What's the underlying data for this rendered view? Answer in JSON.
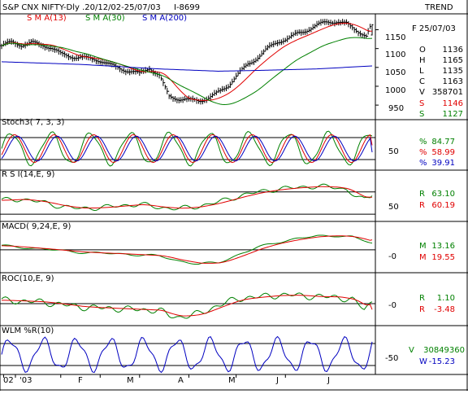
{
  "header": {
    "title": "S&P CNX NIFTY-Dly .20/12/02-25/07/03",
    "code": "I-8699",
    "trend_label": "TREND"
  },
  "colors": {
    "price": "#000000",
    "sma13": "#e00000",
    "sma30": "#008000",
    "sma200": "#0000c0",
    "osc_green": "#008000",
    "osc_red": "#e00000",
    "osc_blue": "#0000c0",
    "wlm": "#0000c0",
    "axis": "#000000"
  },
  "chart_data": [
    {
      "type": "line",
      "panel": "price",
      "title": "S&P CNX NIFTY-Dly .20/12/02-25/07/03",
      "ylim": [
        920,
        1190
      ],
      "y_ticks": [
        "1150",
        "1100",
        "1050",
        "1000",
        "950"
      ],
      "legend": [
        {
          "name": "S M A(13)",
          "color": "#e00000"
        },
        {
          "name": "S M A(30)",
          "color": "#008000"
        },
        {
          "name": "S M A(200)",
          "color": "#0000c0"
        }
      ],
      "readout": {
        "date": "F 25/07/03",
        "items": [
          {
            "k": "O",
            "v": "1136",
            "color": "#000000"
          },
          {
            "k": "H",
            "v": "1165",
            "color": "#000000"
          },
          {
            "k": "L",
            "v": "1135",
            "color": "#000000"
          },
          {
            "k": "C",
            "v": "1163",
            "color": "#000000"
          },
          {
            "k": "V",
            "v": "358701",
            "color": "#000000"
          },
          {
            "k": "S",
            "v": "1146",
            "color": "#e00000"
          },
          {
            "k": "S",
            "v": "1127",
            "color": "#008000"
          }
        ]
      },
      "close_anchors": [
        [
          0,
          1105
        ],
        [
          5,
          1115
        ],
        [
          10,
          1112
        ],
        [
          15,
          1118
        ],
        [
          20,
          1108
        ],
        [
          25,
          1100
        ],
        [
          30,
          1085
        ],
        [
          35,
          1082
        ],
        [
          40,
          1078
        ],
        [
          45,
          1070
        ],
        [
          50,
          1066
        ],
        [
          55,
          1058
        ],
        [
          60,
          1050
        ],
        [
          65,
          1040
        ],
        [
          70,
          1030
        ],
        [
          75,
          1048
        ],
        [
          80,
          1030
        ],
        [
          85,
          975
        ],
        [
          90,
          965
        ],
        [
          95,
          960
        ],
        [
          100,
          962
        ],
        [
          105,
          972
        ],
        [
          110,
          985
        ],
        [
          115,
          1000
        ],
        [
          120,
          1030
        ],
        [
          125,
          1060
        ],
        [
          130,
          1080
        ],
        [
          135,
          1100
        ],
        [
          140,
          1115
        ],
        [
          145,
          1125
        ],
        [
          150,
          1142
        ],
        [
          155,
          1152
        ],
        [
          160,
          1160
        ],
        [
          165,
          1168
        ],
        [
          170,
          1172
        ],
        [
          175,
          1168
        ],
        [
          180,
          1150
        ],
        [
          185,
          1130
        ],
        [
          188,
          1163
        ]
      ],
      "sma200_anchors": [
        [
          0,
          1065
        ],
        [
          40,
          1058
        ],
        [
          80,
          1046
        ],
        [
          110,
          1040
        ],
        [
          130,
          1042
        ],
        [
          160,
          1046
        ],
        [
          188,
          1054
        ]
      ],
      "sma13_final": 1146,
      "sma30_final": 1127
    },
    {
      "type": "line",
      "panel": "stoch",
      "title": "Stoch3( 7, 3, 3)",
      "ylim": [
        0,
        100
      ],
      "y_ticks": [
        "50"
      ],
      "ref_lines": [
        20,
        80
      ],
      "readout": {
        "items": [
          {
            "k": "%",
            "v": "84.77",
            "color": "#008000"
          },
          {
            "k": "%",
            "v": "58.99",
            "color": "#e00000"
          },
          {
            "k": "%",
            "v": "39.91",
            "color": "#0000c0"
          }
        ]
      }
    },
    {
      "type": "line",
      "panel": "rsi",
      "title": "R S I(14,E, 9)",
      "ylim": [
        20,
        90
      ],
      "y_ticks": [
        "50"
      ],
      "ref_lines": [
        70,
        30
      ],
      "readout": {
        "items": [
          {
            "k": "R",
            "v": "63.10",
            "color": "#008000"
          },
          {
            "k": "R",
            "v": "60.19",
            "color": "#e00000"
          }
        ]
      },
      "anchors": [
        [
          0,
          55
        ],
        [
          10,
          57
        ],
        [
          20,
          52
        ],
        [
          30,
          44
        ],
        [
          40,
          40
        ],
        [
          50,
          42
        ],
        [
          60,
          45
        ],
        [
          70,
          48
        ],
        [
          80,
          42
        ],
        [
          90,
          40
        ],
        [
          100,
          44
        ],
        [
          110,
          52
        ],
        [
          120,
          62
        ],
        [
          130,
          70
        ],
        [
          140,
          75
        ],
        [
          150,
          78
        ],
        [
          160,
          80
        ],
        [
          170,
          78
        ],
        [
          175,
          74
        ],
        [
          180,
          62
        ],
        [
          184,
          55
        ],
        [
          188,
          63
        ]
      ]
    },
    {
      "type": "line",
      "panel": "macd",
      "title": "MACD( 9,24,E, 9)",
      "ylim": [
        -45,
        35
      ],
      "y_ticks": [
        "-0"
      ],
      "ref_lines": [
        0
      ],
      "readout": {
        "items": [
          {
            "k": "M",
            "v": "13.16",
            "color": "#008000"
          },
          {
            "k": "M",
            "v": "19.55",
            "color": "#e00000"
          }
        ]
      },
      "anchors": [
        [
          0,
          8
        ],
        [
          20,
          2
        ],
        [
          40,
          -5
        ],
        [
          60,
          -8
        ],
        [
          80,
          -12
        ],
        [
          90,
          -22
        ],
        [
          100,
          -28
        ],
        [
          110,
          -25
        ],
        [
          120,
          -10
        ],
        [
          130,
          5
        ],
        [
          140,
          15
        ],
        [
          150,
          22
        ],
        [
          160,
          27
        ],
        [
          170,
          28
        ],
        [
          178,
          25
        ],
        [
          184,
          18
        ],
        [
          188,
          13
        ]
      ]
    },
    {
      "type": "line",
      "panel": "roc",
      "title": "ROC(10,E, 9)",
      "ylim": [
        -12,
        12
      ],
      "y_ticks": [
        "-0"
      ],
      "ref_lines": [
        0
      ],
      "readout": {
        "items": [
          {
            "k": "R",
            "v": "1.10",
            "color": "#008000"
          },
          {
            "k": "R",
            "v": "-3.48",
            "color": "#e00000"
          }
        ]
      },
      "anchors": [
        [
          0,
          2
        ],
        [
          20,
          1
        ],
        [
          40,
          -2
        ],
        [
          60,
          -3
        ],
        [
          80,
          -4
        ],
        [
          85,
          -7
        ],
        [
          90,
          -8
        ],
        [
          100,
          -6
        ],
        [
          110,
          -1
        ],
        [
          120,
          3
        ],
        [
          130,
          4
        ],
        [
          140,
          5
        ],
        [
          150,
          5
        ],
        [
          160,
          4
        ],
        [
          170,
          4
        ],
        [
          178,
          2
        ],
        [
          184,
          -3
        ],
        [
          188,
          1
        ]
      ]
    },
    {
      "type": "line",
      "panel": "wlm",
      "title": "WLM %R(10)",
      "ylim": [
        -100,
        0
      ],
      "y_ticks": [
        "-50"
      ],
      "ref_lines": [
        -20,
        -80
      ],
      "readout": {
        "items": [
          {
            "k": "V",
            "v": "30849360",
            "color": "#008000"
          },
          {
            "k": "W",
            "v": "-15.23",
            "color": "#0000c0"
          }
        ]
      }
    }
  ],
  "x_axis": {
    "labels": [
      {
        "text": "02",
        "idx": 1
      },
      {
        "text": "'03",
        "idx": 7
      },
      {
        "text": "F",
        "idx": 30
      },
      {
        "text": "M",
        "idx": 50
      },
      {
        "text": "A",
        "idx": 70
      },
      {
        "text": "M",
        "idx": 95
      },
      {
        "text": "J",
        "idx": 119
      },
      {
        "text": "J",
        "idx": 144
      }
    ]
  }
}
